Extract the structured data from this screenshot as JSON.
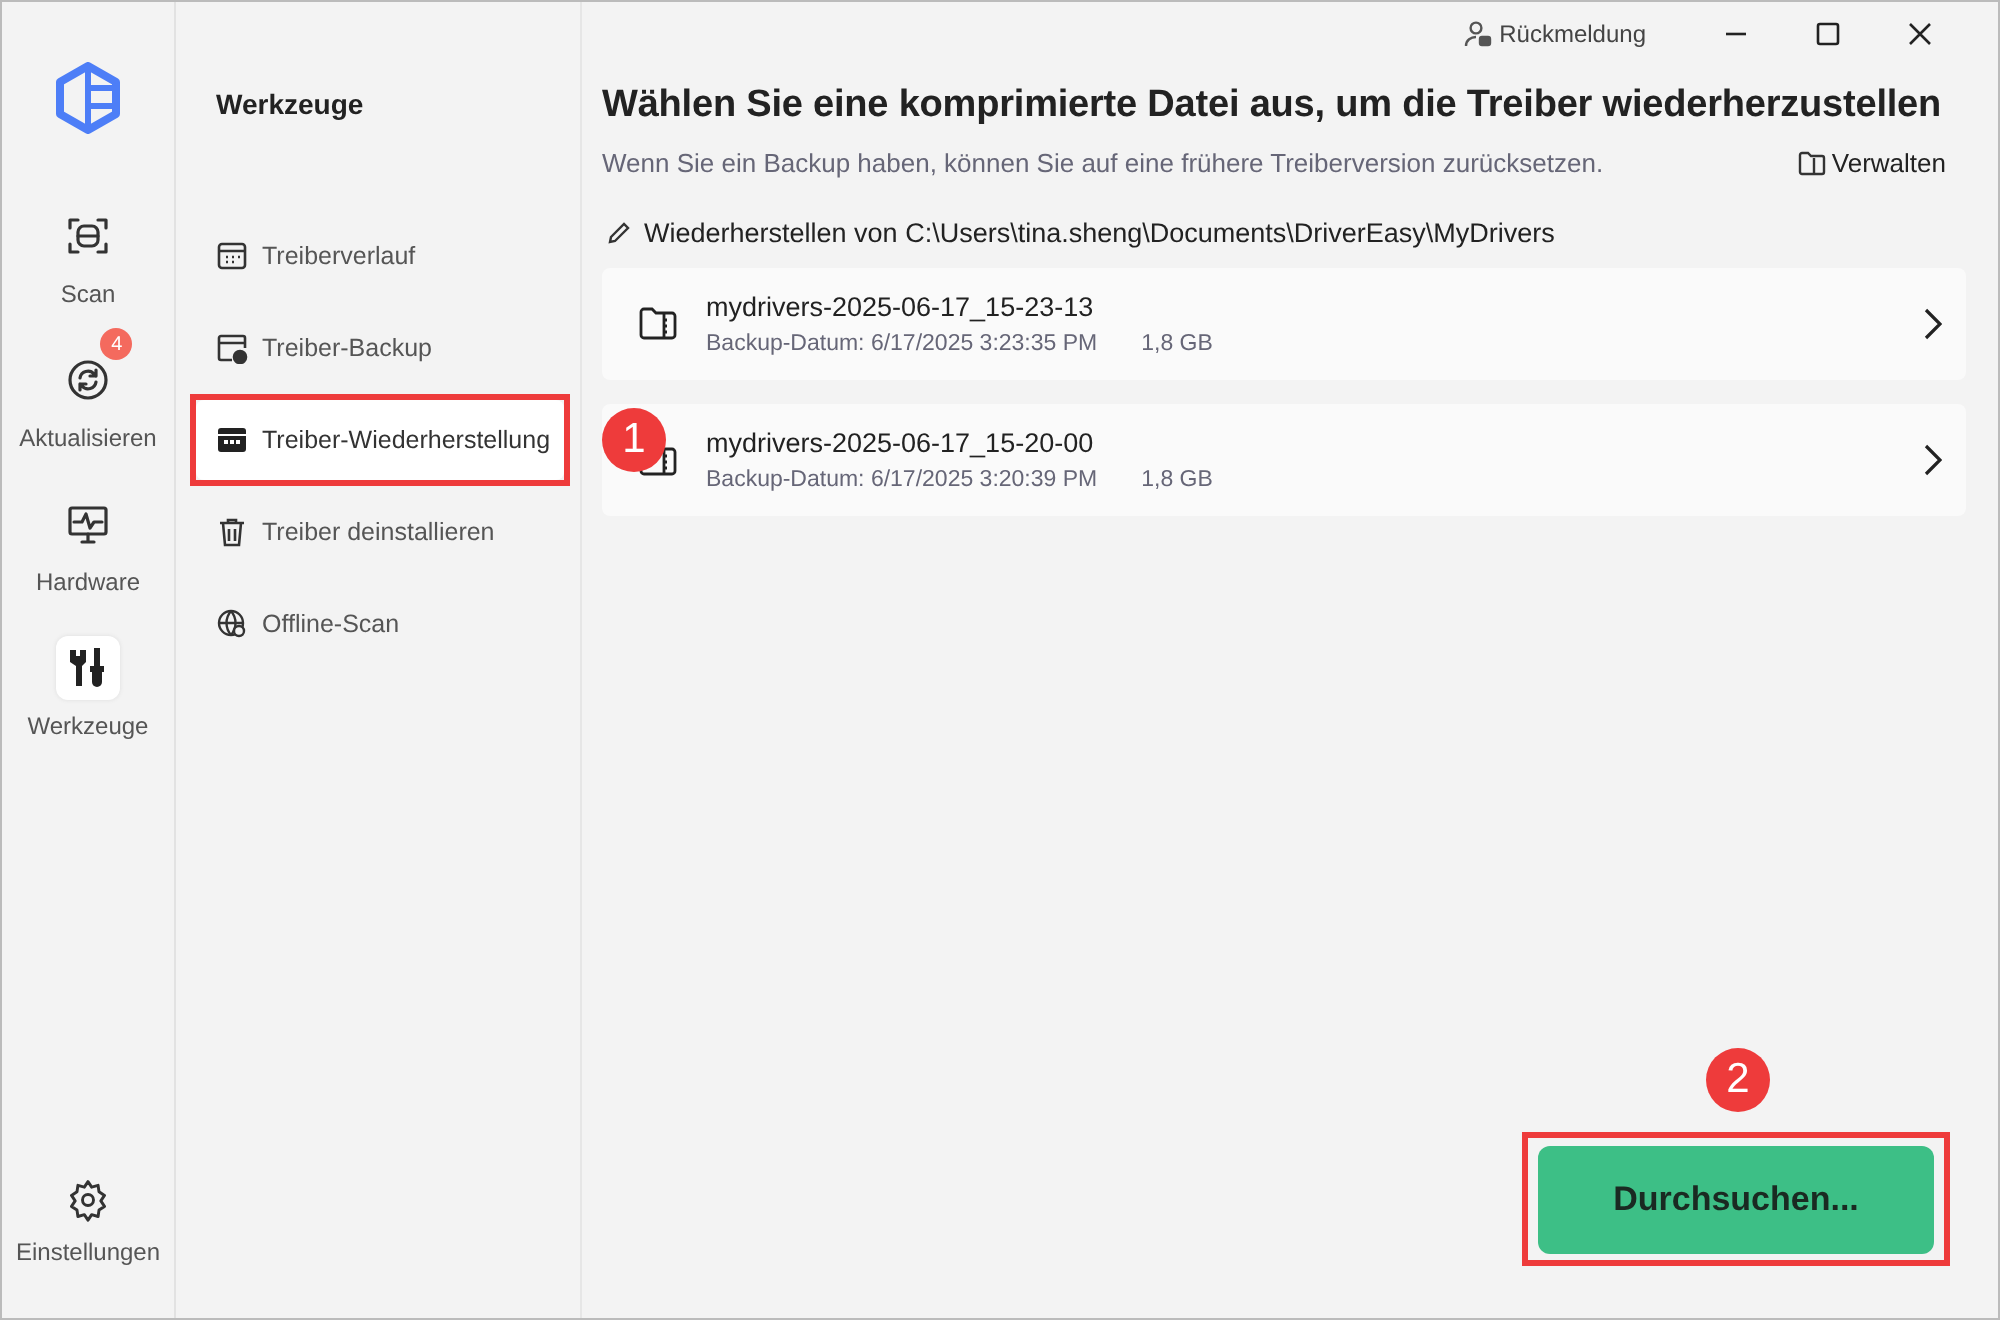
{
  "window": {
    "feedback": "Rückmeldung"
  },
  "rail": {
    "items": [
      {
        "label": "Scan",
        "selected": false
      },
      {
        "label": "Aktualisieren",
        "selected": false,
        "badge": "4"
      },
      {
        "label": "Hardware",
        "selected": false
      },
      {
        "label": "Werkzeuge",
        "selected": true
      }
    ],
    "settings": "Einstellungen"
  },
  "tools": {
    "title": "Werkzeuge",
    "items": [
      {
        "label": "Treiberverlauf",
        "selected": false
      },
      {
        "label": "Treiber-Backup",
        "selected": false
      },
      {
        "label": "Treiber-Wiederherstellung",
        "selected": true,
        "callout": "1"
      },
      {
        "label": "Treiber deinstallieren",
        "selected": false
      },
      {
        "label": "Offline-Scan",
        "selected": false
      }
    ]
  },
  "main": {
    "heading": "Wählen Sie eine komprimierte Datei aus, um die Treiber wiederherzustellen",
    "subtitle": "Wenn Sie ein Backup haben, können Sie auf eine frühere Treiberversion zurücksetzen.",
    "manage": "Verwalten",
    "path": "Wiederherstellen von C:\\Users\\tina.sheng\\Documents\\DriverEasy\\MyDrivers",
    "backups": [
      {
        "name": "mydrivers-2025-06-17_15-23-13",
        "date": "Backup-Datum: 6/17/2025 3:23:35 PM",
        "size": "1,8 GB"
      },
      {
        "name": "mydrivers-2025-06-17_15-20-00",
        "date": "Backup-Datum: 6/17/2025 3:20:39 PM",
        "size": "1,8 GB"
      }
    ],
    "browse_button": {
      "label": "Durchsuchen...",
      "callout": "2"
    }
  }
}
